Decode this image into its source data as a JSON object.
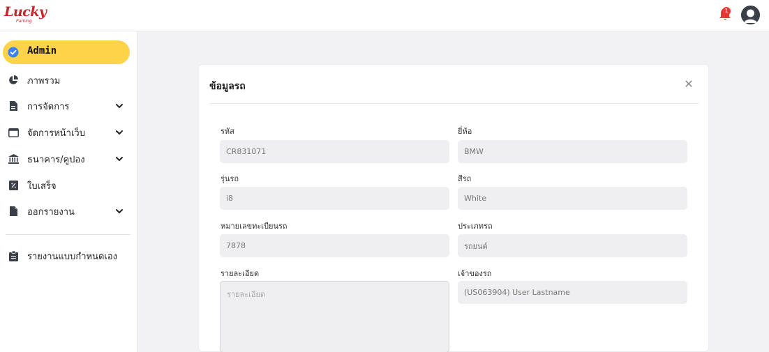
{
  "app": {
    "logo_text": "Lucky",
    "logo_sub": "Parking",
    "notification_count": "1"
  },
  "sidebar": {
    "active_label": "Admin",
    "items": [
      {
        "label": "ภาพรวม",
        "icon": "pie-chart-icon",
        "has_chevron": false
      },
      {
        "label": "การจัดการ",
        "icon": "document-icon",
        "has_chevron": true
      },
      {
        "label": "จัดการหน้าเว็บ",
        "icon": "browser-window-icon",
        "has_chevron": true
      },
      {
        "label": "ธนาคาร/คูปอง",
        "icon": "bank-icon",
        "has_chevron": true
      },
      {
        "label": "ใบเสร็จ",
        "icon": "receipt-percent-icon",
        "has_chevron": false
      },
      {
        "label": "ออกรายงาน",
        "icon": "file-report-icon",
        "has_chevron": true
      }
    ],
    "custom_report_label": "รายงานแบบกำหนดเอง"
  },
  "modal": {
    "title": "ข้อมูลรถ",
    "fields": {
      "code": {
        "label": "รหัส",
        "value": "CR831071"
      },
      "brand": {
        "label": "ยี่ห้อ",
        "value": "BMW"
      },
      "model": {
        "label": "รุ่นรถ",
        "value": "i8"
      },
      "color": {
        "label": "สีรถ",
        "value": "White"
      },
      "plate": {
        "label": "หมายเลขทะเบียนรถ",
        "value": "7878"
      },
      "type": {
        "label": "ประเภทรถ",
        "value": "รถยนต์"
      },
      "detail": {
        "label": "รายละเอียด",
        "value": "",
        "placeholder": "รายละเอียด"
      },
      "owner": {
        "label": "เจ้าของรถ",
        "value": "(US063904) User Lastname"
      }
    }
  },
  "colors": {
    "accent": "#fdd34a",
    "brand": "#c8242a",
    "badge": "#e53935"
  }
}
